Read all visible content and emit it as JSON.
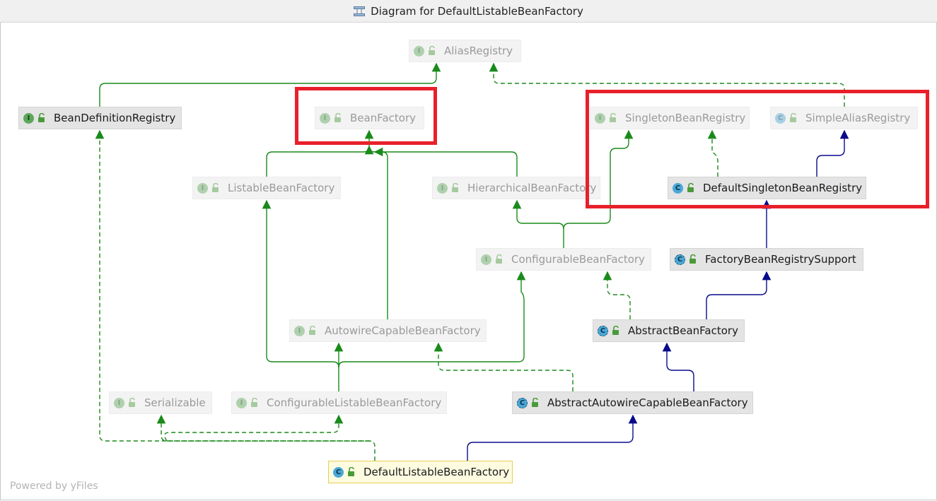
{
  "window": {
    "title": "Diagram for DefaultListableBeanFactory"
  },
  "watermark": "Powered by yFiles",
  "colors": {
    "implements": "#1a8a1a",
    "extends": "#0a0a8c",
    "highlight": "#e8202a",
    "selected_border": "#e8cf52"
  },
  "nodes": [
    {
      "id": "AliasRegistry",
      "label": "AliasRegistry",
      "kind": "interface",
      "state": "dim"
    },
    {
      "id": "BeanDefinitionRegistry",
      "label": "BeanDefinitionRegistry",
      "kind": "interface",
      "state": "active"
    },
    {
      "id": "BeanFactory",
      "label": "BeanFactory",
      "kind": "interface",
      "state": "dim"
    },
    {
      "id": "SingletonBeanRegistry",
      "label": "SingletonBeanRegistry",
      "kind": "interface",
      "state": "dim"
    },
    {
      "id": "SimpleAliasRegistry",
      "label": "SimpleAliasRegistry",
      "kind": "class",
      "state": "dim"
    },
    {
      "id": "ListableBeanFactory",
      "label": "ListableBeanFactory",
      "kind": "interface",
      "state": "dim"
    },
    {
      "id": "HierarchicalBeanFactory",
      "label": "HierarchicalBeanFactory",
      "kind": "interface",
      "state": "dim"
    },
    {
      "id": "DefaultSingletonBeanRegistry",
      "label": "DefaultSingletonBeanRegistry",
      "kind": "class",
      "state": "active"
    },
    {
      "id": "ConfigurableBeanFactory",
      "label": "ConfigurableBeanFactory",
      "kind": "interface",
      "state": "dim"
    },
    {
      "id": "FactoryBeanRegistrySupport",
      "label": "FactoryBeanRegistrySupport",
      "kind": "abstract",
      "state": "active"
    },
    {
      "id": "AutowireCapableBeanFactory",
      "label": "AutowireCapableBeanFactory",
      "kind": "interface",
      "state": "dim"
    },
    {
      "id": "AbstractBeanFactory",
      "label": "AbstractBeanFactory",
      "kind": "abstract",
      "state": "active"
    },
    {
      "id": "Serializable",
      "label": "Serializable",
      "kind": "interface",
      "state": "dim"
    },
    {
      "id": "ConfigurableListableBeanFactory",
      "label": "ConfigurableListableBeanFactory",
      "kind": "interface",
      "state": "dim"
    },
    {
      "id": "AbstractAutowireCapableBeanFactory",
      "label": "AbstractAutowireCapableBeanFactory",
      "kind": "abstract",
      "state": "active"
    },
    {
      "id": "DefaultListableBeanFactory",
      "label": "DefaultListableBeanFactory",
      "kind": "class",
      "state": "selected"
    }
  ],
  "edges": [
    {
      "from": "BeanDefinitionRegistry",
      "to": "AliasRegistry",
      "type": "interface-extends"
    },
    {
      "from": "SimpleAliasRegistry",
      "to": "AliasRegistry",
      "type": "implements"
    },
    {
      "from": "ListableBeanFactory",
      "to": "BeanFactory",
      "type": "interface-extends"
    },
    {
      "from": "HierarchicalBeanFactory",
      "to": "BeanFactory",
      "type": "interface-extends"
    },
    {
      "from": "AutowireCapableBeanFactory",
      "to": "BeanFactory",
      "type": "interface-extends"
    },
    {
      "from": "DefaultSingletonBeanRegistry",
      "to": "SingletonBeanRegistry",
      "type": "implements"
    },
    {
      "from": "DefaultSingletonBeanRegistry",
      "to": "SimpleAliasRegistry",
      "type": "extends"
    },
    {
      "from": "ConfigurableBeanFactory",
      "to": "HierarchicalBeanFactory",
      "type": "interface-extends"
    },
    {
      "from": "ConfigurableBeanFactory",
      "to": "SingletonBeanRegistry",
      "type": "interface-extends"
    },
    {
      "from": "FactoryBeanRegistrySupport",
      "to": "DefaultSingletonBeanRegistry",
      "type": "extends"
    },
    {
      "from": "AbstractBeanFactory",
      "to": "ConfigurableBeanFactory",
      "type": "implements"
    },
    {
      "from": "AbstractBeanFactory",
      "to": "FactoryBeanRegistrySupport",
      "type": "extends"
    },
    {
      "from": "ConfigurableListableBeanFactory",
      "to": "ListableBeanFactory",
      "type": "interface-extends"
    },
    {
      "from": "ConfigurableListableBeanFactory",
      "to": "AutowireCapableBeanFactory",
      "type": "interface-extends"
    },
    {
      "from": "ConfigurableListableBeanFactory",
      "to": "ConfigurableBeanFactory",
      "type": "interface-extends"
    },
    {
      "from": "AbstractAutowireCapableBeanFactory",
      "to": "AutowireCapableBeanFactory",
      "type": "implements"
    },
    {
      "from": "AbstractAutowireCapableBeanFactory",
      "to": "AbstractBeanFactory",
      "type": "extends"
    },
    {
      "from": "DefaultListableBeanFactory",
      "to": "BeanDefinitionRegistry",
      "type": "implements"
    },
    {
      "from": "DefaultListableBeanFactory",
      "to": "Serializable",
      "type": "implements"
    },
    {
      "from": "DefaultListableBeanFactory",
      "to": "ConfigurableListableBeanFactory",
      "type": "implements"
    },
    {
      "from": "DefaultListableBeanFactory",
      "to": "AbstractAutowireCapableBeanFactory",
      "type": "extends"
    }
  ],
  "highlights": [
    {
      "around": [
        "BeanFactory"
      ]
    },
    {
      "around": [
        "SingletonBeanRegistry",
        "SimpleAliasRegistry",
        "DefaultSingletonBeanRegistry"
      ]
    }
  ]
}
